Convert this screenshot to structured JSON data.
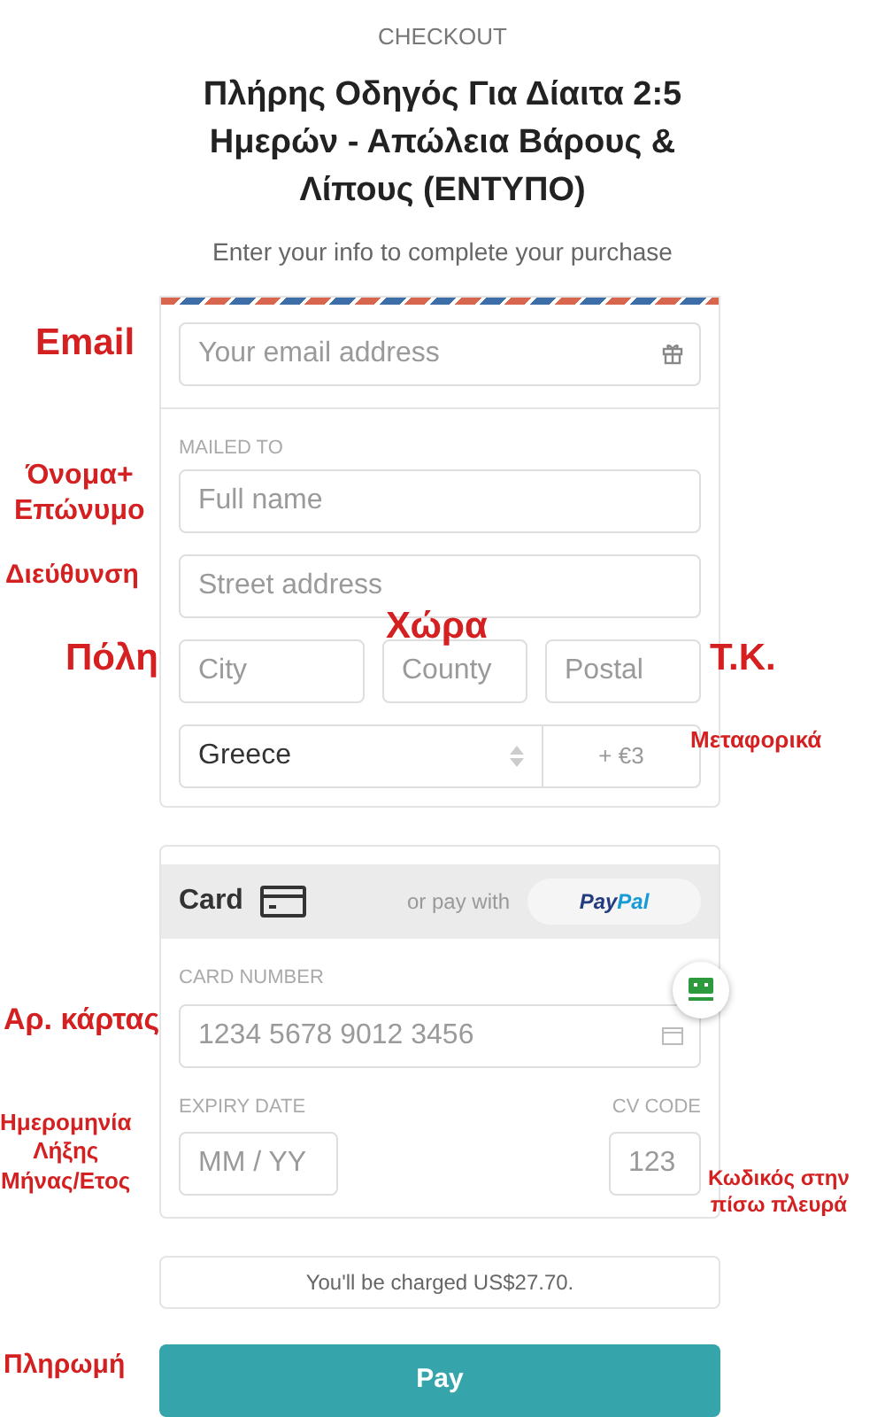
{
  "header": {
    "eyebrow": "CHECKOUT",
    "title": "Πλήρης Οδηγός Για Δίαιτα 2:5 Ημερών - Απώλεια Βάρους & Λίπους (ΕΝΤΥΠΟ)",
    "subtitle": "Enter your info to complete your purchase"
  },
  "contact": {
    "email": {
      "placeholder": "Your email address"
    },
    "section_label": "MAILED TO",
    "full_name": {
      "placeholder": "Full name"
    },
    "street": {
      "placeholder": "Street address"
    },
    "city": {
      "placeholder": "City"
    },
    "county": {
      "placeholder": "County"
    },
    "postal": {
      "placeholder": "Postal"
    },
    "country": {
      "value": "Greece"
    },
    "shipping": "+ €3"
  },
  "payment": {
    "tabs": [
      {
        "label": "Card",
        "selected": true
      }
    ],
    "alt_label": "or pay with",
    "paypal": {
      "pay": "Pay",
      "pal": "Pal"
    },
    "card_number": {
      "label": "CARD NUMBER",
      "placeholder": "1234 5678 9012 3456"
    },
    "expiry": {
      "label": "EXPIRY DATE",
      "placeholder": "MM / YY"
    },
    "cvc": {
      "label": "CV CODE",
      "placeholder": "123"
    }
  },
  "charge_note": "You'll be charged US$27.70.",
  "pay_button": "Pay",
  "annotations": [
    {
      "lines": [
        "Email"
      ]
    },
    {
      "lines": [
        "Όνομα+",
        "Επώνυμο"
      ]
    },
    {
      "lines": [
        "Διεύθυνση"
      ]
    },
    {
      "lines": [
        "Πόλη"
      ]
    },
    {
      "lines": [
        "Χώρα"
      ]
    },
    {
      "lines": [
        "Τ.Κ."
      ]
    },
    {
      "lines": [
        "Μεταφορικά"
      ]
    },
    {
      "lines": [
        "Αρ. κάρτας"
      ]
    },
    {
      "lines": [
        "Ημερομηνία",
        "Λήξης",
        "Μήνας/Ετος"
      ]
    },
    {
      "lines": [
        "Κωδικός στην",
        "πίσω πλευρά"
      ]
    },
    {
      "lines": [
        "Πληρωμή"
      ]
    }
  ]
}
